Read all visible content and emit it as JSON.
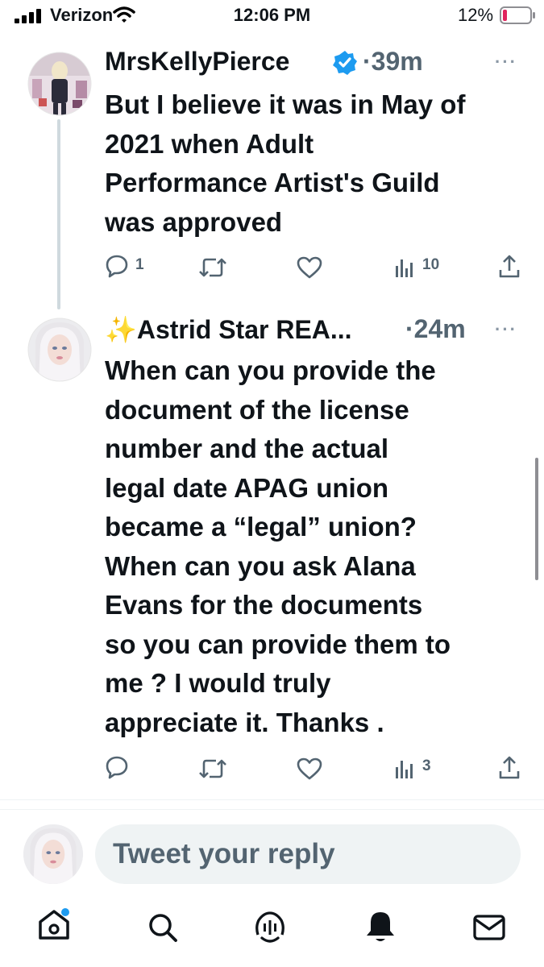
{
  "status_bar": {
    "carrier": "Verizon",
    "time": "12:06 PM",
    "battery": "12%"
  },
  "tweets": [
    {
      "author": "MrsKellyPierce",
      "verified": true,
      "time": "·39m",
      "text": "But I believe it was in May of\n2021 when Adult\nPerformance Artist's Guild\nwas approved",
      "replies": "1",
      "views": "10"
    },
    {
      "author": "✨Astrid Star REA...",
      "time": "·24m",
      "text": "When can you provide the\ndocument of the license\nnumber and the actual\nlegal date APAG union\nbecame a “legal” union?\nWhen can you ask Alana\nEvans for the documents\nso you can provide them to\nme ? I would truly\nappreciate it. Thanks .",
      "views": "3"
    }
  ],
  "reply": {
    "placeholder": "Tweet your reply"
  },
  "more_glyph": "···",
  "colors": {
    "verified_blue": "#1d9bf0",
    "text": "#0f1419",
    "secondary": "#536471",
    "battery_low": "#e0245e"
  },
  "icons": [
    "signal-icon",
    "wifi-icon",
    "battery-icon",
    "verified-icon",
    "reply-icon",
    "retweet-icon",
    "like-icon",
    "views-icon",
    "share-icon",
    "home-icon",
    "search-icon",
    "spaces-icon",
    "notifications-icon",
    "messages-icon"
  ]
}
